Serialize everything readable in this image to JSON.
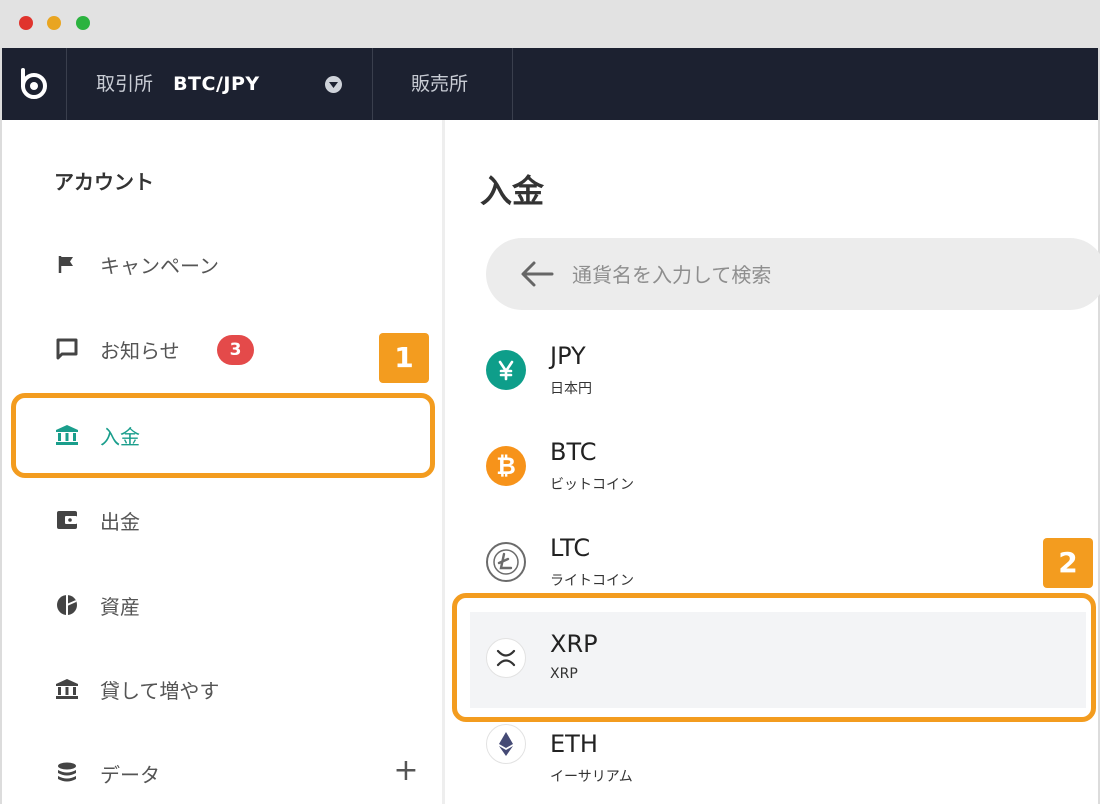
{
  "window": {
    "dots": [
      {
        "name": "close-dot",
        "color": "#e0342d"
      },
      {
        "name": "minimize-dot",
        "color": "#e9a521"
      },
      {
        "name": "maximize-dot",
        "color": "#2bb33f"
      }
    ]
  },
  "topnav": {
    "logo_icon": "brand-logo-icon",
    "exchange_label": "取引所",
    "pair": "BTC/JPY",
    "pair_dropdown_icon": "chevron-down-icon",
    "sales_label": "販売所"
  },
  "sidebar": {
    "heading": "アカウント",
    "items": [
      {
        "label": "キャンペーン",
        "icon": "flag-icon"
      },
      {
        "label": "お知らせ",
        "icon": "message-icon",
        "badge": "3"
      },
      {
        "label": "入金",
        "icon": "bank-icon",
        "active": true
      },
      {
        "label": "出金",
        "icon": "wallet-icon"
      },
      {
        "label": "資産",
        "icon": "pie-chart-icon"
      },
      {
        "label": "貸して増やす",
        "icon": "bank-icon"
      },
      {
        "label": "データ",
        "icon": "database-icon",
        "expand": "+"
      }
    ]
  },
  "main": {
    "title": "入金",
    "search": {
      "placeholder": "通貨名を入力して検索",
      "icon": "arrow-left-icon"
    },
    "currencies": [
      {
        "symbol": "JPY",
        "name": "日本円",
        "icon": "yen-icon",
        "color": "#0e9e8a"
      },
      {
        "symbol": "BTC",
        "name": "ビットコイン",
        "icon": "bitcoin-icon",
        "color": "#f7931a"
      },
      {
        "symbol": "LTC",
        "name": "ライトコイン",
        "icon": "litecoin-icon",
        "color": "#6b6b6b"
      },
      {
        "symbol": "XRP",
        "name": "XRP",
        "icon": "xrp-icon",
        "color": "#333333",
        "selected": true
      },
      {
        "symbol": "ETH",
        "name": "イーサリアム",
        "icon": "ethereum-icon",
        "color": "#454a75"
      }
    ]
  },
  "callouts": [
    {
      "number": "1",
      "target": "sidebar-item-deposit"
    },
    {
      "number": "2",
      "target": "currency-row-xrp"
    }
  ],
  "colors": {
    "accent": "#1a9e8c",
    "highlight": "#f39c1f",
    "nav_bg": "#1c2130",
    "badge": "#e44a4a"
  }
}
